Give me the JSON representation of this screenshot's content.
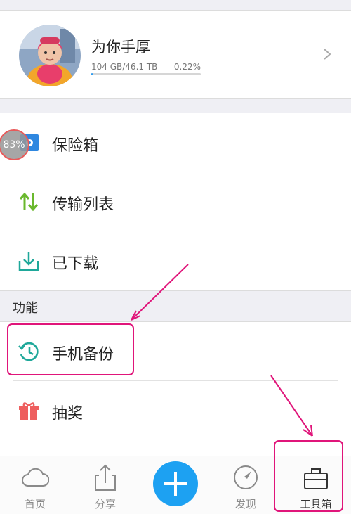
{
  "profile": {
    "username": "为你手厚",
    "quota_used": "104 GB/46.1 TB",
    "quota_percent": "0.22%",
    "quota_fraction": 0.0022
  },
  "menu": {
    "items": [
      {
        "label": "保险箱",
        "icon": "safe-box-icon"
      },
      {
        "label": "传输列表",
        "icon": "transfer-arrows-icon"
      },
      {
        "label": "已下载",
        "icon": "download-tray-icon"
      }
    ],
    "section_title": "功能",
    "features": [
      {
        "label": "手机备份",
        "icon": "clock-backup-icon"
      },
      {
        "label": "抽奖",
        "icon": "gift-icon"
      }
    ]
  },
  "tabbar": {
    "tabs": [
      {
        "label": "首页",
        "icon": "cloud-icon"
      },
      {
        "label": "分享",
        "icon": "share-icon"
      },
      {
        "label": "发现",
        "icon": "compass-icon"
      },
      {
        "label": "工具箱",
        "icon": "toolbox-icon"
      }
    ],
    "center_action": "plus-icon"
  },
  "overlay": {
    "progress_badge": "83%"
  },
  "colors": {
    "accent": "#1da1f2",
    "annotation": "#e0157a",
    "green": "#6ab82d",
    "teal": "#1fa89a",
    "gift": "#ee5f5f"
  }
}
